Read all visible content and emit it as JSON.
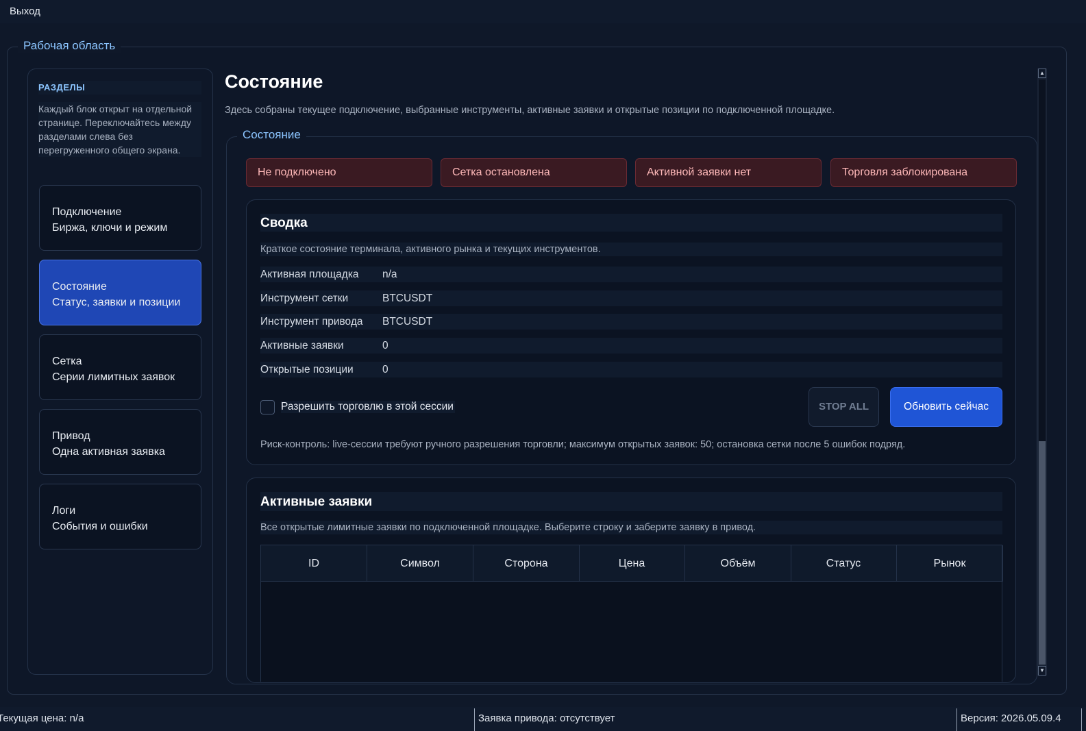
{
  "menubar": {
    "exit_label": "Выход"
  },
  "workspace": {
    "title": "Рабочая область"
  },
  "sidebar": {
    "title": "РАЗДЕЛЫ",
    "hint": "Каждый блок открыт на отдельной странице. Переключайтесь между разделами слева без перегруженного общего экрана.",
    "items": [
      {
        "title": "Подключение",
        "subtitle": "Биржа, ключи и режим",
        "active": false
      },
      {
        "title": "Состояние",
        "subtitle": "Статус, заявки и позиции",
        "active": true
      },
      {
        "title": "Сетка",
        "subtitle": "Серии лимитных заявок",
        "active": false
      },
      {
        "title": "Привод",
        "subtitle": "Одна активная заявка",
        "active": false
      },
      {
        "title": "Логи",
        "subtitle": "События и ошибки",
        "active": false
      }
    ]
  },
  "main": {
    "title": "Состояние",
    "description": "Здесь собраны текущее подключение, выбранные инструменты, активные заявки и открытые позиции по подключенной площадке.",
    "group_title": "Состояние",
    "statuses": [
      "Не подключено",
      "Сетка остановлена",
      "Активной заявки нет",
      "Торговля заблокирована"
    ],
    "summary": {
      "title": "Сводка",
      "description": "Краткое состояние терминала, активного рынка и текущих инструментов.",
      "rows": [
        {
          "key": "Активная площадка",
          "value": "n/a"
        },
        {
          "key": "Инструмент сетки",
          "value": "BTCUSDT"
        },
        {
          "key": "Инструмент привода",
          "value": "BTCUSDT"
        },
        {
          "key": "Активные заявки",
          "value": "0"
        },
        {
          "key": "Открытые позиции",
          "value": "0"
        }
      ],
      "allow_trading_label": "Разрешить торговлю в этой сессии",
      "allow_trading_checked": false,
      "stop_all_label": "STOP ALL",
      "refresh_label": "Обновить сейчас",
      "risk_note": "Риск-контроль: live-сессии требуют ручного разрешения торговли; максимум открытых заявок: 50; остановка сетки после 5 ошибок подряд."
    },
    "orders": {
      "title": "Активные заявки",
      "description": "Все открытые лимитные заявки по подключенной площадке. Выберите строку и заберите заявку в привод.",
      "columns": [
        "ID",
        "Символ",
        "Сторона",
        "Цена",
        "Объём",
        "Статус",
        "Рынок"
      ],
      "rows": []
    }
  },
  "statusbar": {
    "price": "Текущая цена: n/a",
    "drive_order": "Заявка привода: отсутствует",
    "version": "Версия: 2026.05.09.4"
  }
}
